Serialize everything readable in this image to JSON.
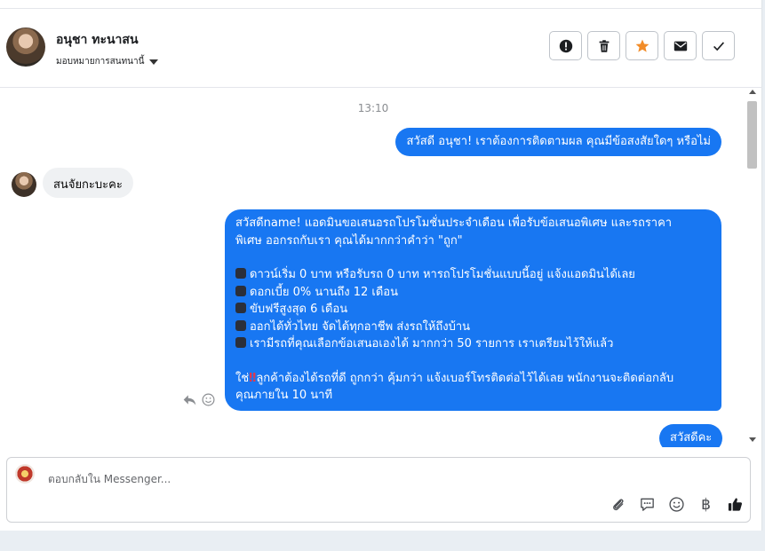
{
  "header": {
    "contact_name": "อนุชา ทะนาสน",
    "assign_label": "มอบหมายการสนทนานี้",
    "actions": [
      {
        "name": "report-icon",
        "glyph": "!"
      },
      {
        "name": "trash-icon"
      },
      {
        "name": "star-icon",
        "color": "#f28c28"
      },
      {
        "name": "mail-icon"
      },
      {
        "name": "checkmark-icon"
      }
    ]
  },
  "chat": {
    "timestamp": "13:10",
    "messages": {
      "m1": "สวัสดี อนุชา! เราต้องการติดตามผล คุณมีข้อสงสัยใดๆ หรือไม่",
      "m2": "สนจัยกะบะคะ",
      "m3_lines": [
        "สวัสดีname! แอดมินขอเสนอรถโปรโมชั่นประจำเดือน เพื่อรับข้อเสนอพิเศษ และรถราคา",
        "พิเศษ ออกรถกับเรา คุณได้มากกว่าคำว่า \"ถูก\"",
        "ดาวน์เริ่ม 0 บาท หรือรับรถ 0 บาท หารถโปรโมชั่นแบบนี้อยู่ แจ้งแอดมินได้เลย",
        "ดอกเบี้ย 0% นานถึง 12 เดือน",
        "ขับฟรีสูงสุด 6 เดือน",
        "ออกได้ทั่วไทย จัดได้ทุกอาชีพ ส่งรถให้ถึงบ้าน",
        "เรามีรถที่คุณเลือกข้อเสนอเองได้ มากกว่า 50 รายการ เราเตรียมไว้ให้แล้ว",
        "ใช่",
        "ลูกค้าต้องได้รถที่ดี ถูกกว่า คุ้มกว่า แจ้งเบอร์โทรติดต่อไว้ได้เลย พนักงานจะติดต่อกลับ",
        "คุณภายใน 10 นาที"
      ],
      "m3_emphasis": "‼",
      "m4": "สวัสดีคะ"
    }
  },
  "composer": {
    "placeholder": "ตอบกลับใน Messenger...",
    "value": "",
    "baht_symbol": "฿"
  },
  "colors": {
    "outgoing_bubble": "#1877f2",
    "incoming_bubble": "#eff1f3"
  }
}
